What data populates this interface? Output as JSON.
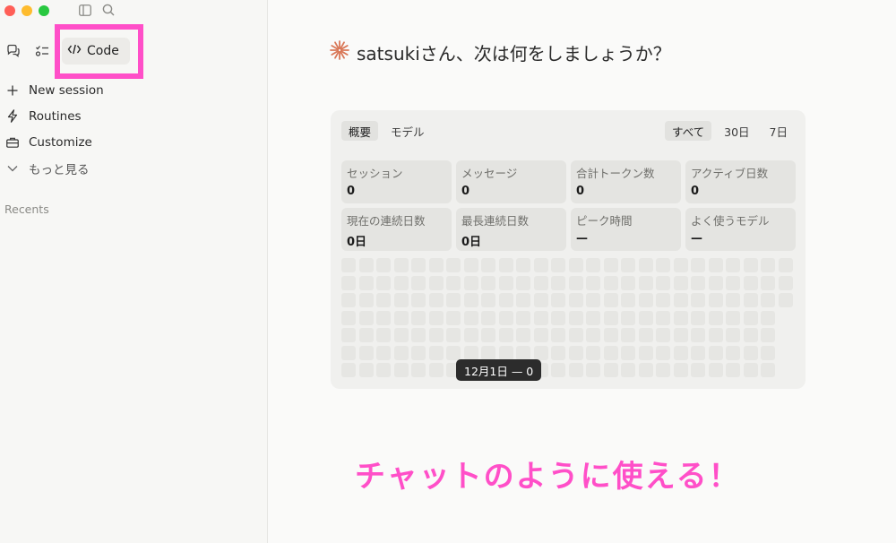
{
  "window": {
    "traffic_lights": [
      "#ff5f57",
      "#febc2e",
      "#28c840"
    ]
  },
  "sidebar": {
    "top_icons": [
      "sidebar-toggle-icon",
      "search-icon"
    ],
    "modes": [
      {
        "icon": "chat-icon"
      },
      {
        "icon": "tasks-icon"
      },
      {
        "icon": "code-icon",
        "label": "Code",
        "active": true
      }
    ],
    "nav": [
      {
        "icon": "plus-icon",
        "label": "New session"
      },
      {
        "icon": "lightning-icon",
        "label": "Routines"
      },
      {
        "icon": "briefcase-icon",
        "label": "Customize"
      },
      {
        "icon": "chevron-down-icon",
        "label": "もっと見る"
      }
    ],
    "recents_label": "Recents"
  },
  "main": {
    "greeting": "satsukiさん、次は何をしましょうか？",
    "greeting_icon": "sparkle-icon",
    "greeting_icon_color": "#d97757",
    "tabs_left": [
      {
        "label": "概要",
        "active": true
      },
      {
        "label": "モデル",
        "active": false
      }
    ],
    "tabs_right": [
      {
        "label": "すべて",
        "active": true
      },
      {
        "label": "30日",
        "active": false
      },
      {
        "label": "7日",
        "active": false
      }
    ],
    "stats": [
      {
        "label": "セッション",
        "value": "0"
      },
      {
        "label": "メッセージ",
        "value": "0"
      },
      {
        "label": "合計トークン数",
        "value": "0"
      },
      {
        "label": "アクティブ日数",
        "value": "0"
      },
      {
        "label": "現在の連続日数",
        "value": "0日"
      },
      {
        "label": "最長連続日数",
        "value": "0日"
      },
      {
        "label": "ピーク時間",
        "value": "—"
      },
      {
        "label": "よく使うモデル",
        "value": "—"
      }
    ],
    "tooltip": "12月1日 — 0",
    "heatmap": {
      "columns": 26,
      "rows": 7,
      "last_column_rows": 3
    }
  },
  "caption": "チャットのように使える！",
  "colors": {
    "highlight": "#ff4fc8",
    "caption": "#ff4fc8"
  }
}
